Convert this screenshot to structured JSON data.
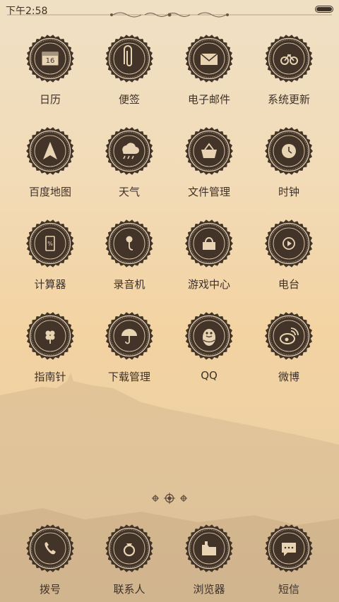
{
  "status": {
    "time": "下午2:58"
  },
  "apps": [
    {
      "label": "日历",
      "icon": "calendar-icon",
      "day": "16"
    },
    {
      "label": "便签",
      "icon": "paperclip-icon"
    },
    {
      "label": "电子邮件",
      "icon": "envelope-icon"
    },
    {
      "label": "系统更新",
      "icon": "bicycle-icon"
    },
    {
      "label": "百度地图",
      "icon": "navigation-arrow-icon"
    },
    {
      "label": "天气",
      "icon": "cloud-rain-icon"
    },
    {
      "label": "文件管理",
      "icon": "basket-icon"
    },
    {
      "label": "时钟",
      "icon": "clock-icon"
    },
    {
      "label": "计算器",
      "icon": "calculator-icon"
    },
    {
      "label": "录音机",
      "icon": "microphone-icon"
    },
    {
      "label": "游戏中心",
      "icon": "bag-icon"
    },
    {
      "label": "电台",
      "icon": "play-circle-icon"
    },
    {
      "label": "指南针",
      "icon": "flower-icon"
    },
    {
      "label": "下载管理",
      "icon": "umbrella-icon"
    },
    {
      "label": "QQ",
      "icon": "penguin-icon"
    },
    {
      "label": "微博",
      "icon": "weibo-icon"
    }
  ],
  "dock": [
    {
      "label": "拨号",
      "icon": "phone-icon"
    },
    {
      "label": "联系人",
      "icon": "ring-icon"
    },
    {
      "label": "浏览器",
      "icon": "folder-icon"
    },
    {
      "label": "短信",
      "icon": "message-icon"
    }
  ],
  "colors": {
    "badge_dark": "#43342a",
    "badge_ring": "#e8d4b2",
    "label": "#3e3128"
  }
}
